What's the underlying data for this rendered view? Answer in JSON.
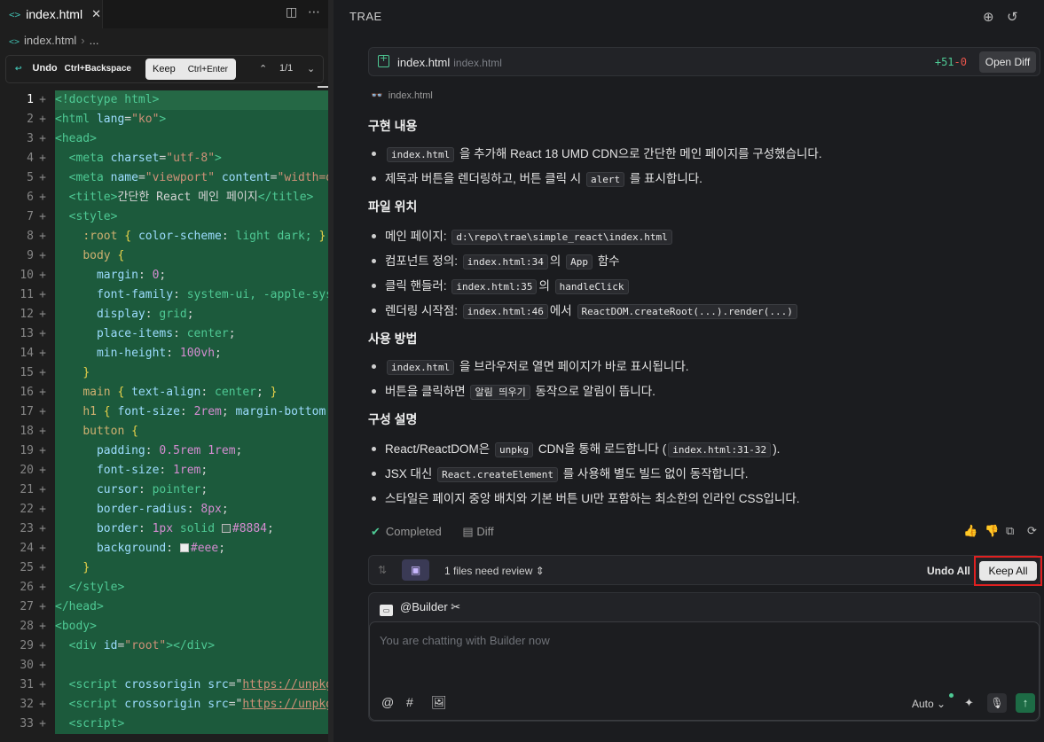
{
  "editor": {
    "tab_label": "index.html",
    "tab_icon": "code-file-icon",
    "breadcrumb_file": "index.html",
    "breadcrumb_more": "...",
    "review": {
      "undo_label": "Undo",
      "undo_shortcut": "Ctrl+Backspace",
      "keep_label": "Keep",
      "keep_shortcut": "Ctrl+Enter",
      "position": "1/1"
    },
    "line_numbers": [
      "1",
      "2",
      "3",
      "4",
      "5",
      "6",
      "7",
      "8",
      "9",
      "10",
      "11",
      "12",
      "13",
      "14",
      "15",
      "16",
      "17",
      "18",
      "19",
      "20",
      "21",
      "22",
      "23",
      "24",
      "25",
      "26",
      "27",
      "28",
      "29",
      "30",
      "31",
      "32",
      "33"
    ],
    "code": {
      "l1_doctype": "<!doctype html>",
      "l2_open": "<html ",
      "l2_attr": "lang",
      "l2_eq": "=",
      "l2_val": "\"ko\"",
      "l2_close": ">",
      "l3": "<head>",
      "l4_open": "<meta ",
      "l4_attr": "charset",
      "l4_val": "\"utf-8\"",
      "l4_close": ">",
      "l5_open": "<meta ",
      "l5_attr1": "name",
      "l5_val1": "\"viewport\"",
      "l5_attr2": "content",
      "l5_val2": "\"width=d",
      "l6_open": "<title>",
      "l6_text": "간단한 React 메인 페이지",
      "l6_close": "</title>",
      "l7": "<style>",
      "l8_sel": ":root",
      "l8_brace_o": "{",
      "l8_prop": "color-scheme",
      "l8_val": "light dark;",
      "l8_brace_c": "}",
      "l9_sel": "body",
      "l9_brace": "{",
      "l10_prop": "margin",
      "l10_val": "0",
      "l11_prop": "font-family",
      "l11_val": "system-ui, -apple-sys",
      "l12_prop": "display",
      "l12_val": "grid",
      "l13_prop": "place-items",
      "l13_val": "center",
      "l14_prop": "min-height",
      "l14_val": "100vh",
      "l15": "}",
      "l16_sel": "main",
      "l16_prop": "text-align",
      "l16_val": "center",
      "l17_sel": "h1",
      "l17_prop": "font-size",
      "l17_val": "2rem",
      "l17_prop2": "margin-bottom:",
      "l18_sel": "button",
      "l19_prop": "padding",
      "l19_val": "0.5rem 1rem",
      "l20_prop": "font-size",
      "l20_val": "1rem",
      "l21_prop": "cursor",
      "l21_val": "pointer",
      "l22_prop": "border-radius",
      "l22_val": "8px",
      "l23_prop": "border",
      "l23_val1": "1px",
      "l23_val2": "solid",
      "l23_color": "#8884",
      "l24_prop": "background",
      "l24_color": "#eee",
      "l25": "}",
      "l26": "</style>",
      "l27": "</head>",
      "l28": "<body>",
      "l29_open": "<div ",
      "l29_attr": "id",
      "l29_val": "\"root\"",
      "l29_close": "></div>",
      "l31_open": "<script ",
      "l31_attr1": "crossorigin",
      "l31_attr2": "src",
      "l31_url": "https://unpkg",
      "l32_open": "<script ",
      "l32_attr1": "crossorigin",
      "l32_attr2": "src",
      "l32_url": "https://unpkg",
      "l33": "<script>"
    }
  },
  "chat": {
    "brand": "TRAE",
    "file_card": {
      "name": "index.html",
      "path": "index.html",
      "additions": "+51",
      "deletions": "-0",
      "open_diff": "Open Diff"
    },
    "viewed_file": "index.html",
    "sections": {
      "impl_title": "구현 내용",
      "impl_1_code": "index.html",
      "impl_1_text": "을 추가해 React 18 UMD CDN으로 간단한 메인 페이지를 구성했습니다.",
      "impl_2_text": "제목과 버튼을 렌더링하고, 버튼 클릭 시",
      "impl_2_code": "alert",
      "impl_2_tail": "를 표시합니다.",
      "loc_title": "파일 위치",
      "loc_1_text": "메인 페이지:",
      "loc_1_code": "d:\\repo\\trae\\simple_react\\index.html",
      "loc_2_text": "컴포넌트 정의:",
      "loc_2_code": "index.html:34",
      "loc_2_mid": "의",
      "loc_2_code2": "App",
      "loc_2_tail": "함수",
      "loc_3_text": "클릭 핸들러:",
      "loc_3_code": "index.html:35",
      "loc_3_mid": "의",
      "loc_3_code2": "handleClick",
      "loc_4_text": "렌더링 시작점:",
      "loc_4_code": "index.html:46",
      "loc_4_mid": "에서",
      "loc_4_code2": "ReactDOM.createRoot(...).render(...)",
      "use_title": "사용 방법",
      "use_1_code": "index.html",
      "use_1_text": "을 브라우저로 열면 페이지가 바로 표시됩니다.",
      "use_2_text": "버튼을 클릭하면",
      "use_2_code": "알림 띄우기",
      "use_2_tail": "동작으로 알림이 뜹니다.",
      "cfg_title": "구성 설명",
      "cfg_1_text": "React/ReactDOM은",
      "cfg_1_code": "unpkg",
      "cfg_1_mid": "CDN을 통해 로드합니다 (",
      "cfg_1_code2": "index.html:31-32",
      "cfg_1_tail": ").",
      "cfg_2_text": "JSX 대신",
      "cfg_2_code": "React.createElement",
      "cfg_2_tail": "를 사용해 별도 빌드 없이 동작합니다.",
      "cfg_3_text": "스타일은 페이지 중앙 배치와 기본 버튼 UI만 포함하는 최소한의 인라인 CSS입니다."
    },
    "status": "Completed",
    "diff_label": "Diff",
    "review_panel": {
      "files_text": "1 files need review",
      "undo_all": "Undo All",
      "keep_all": "Keep All"
    },
    "composer": {
      "agent": "@Builder",
      "placeholder": "You are chatting with Builder now",
      "model": "Auto"
    },
    "colors": {
      "accent_green": "#4ec994",
      "diff_highlight": "#1c5a3c",
      "highlight_box": "#e02020"
    }
  }
}
